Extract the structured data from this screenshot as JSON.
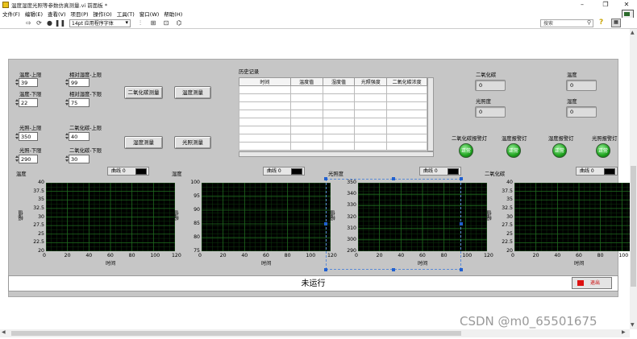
{
  "window": {
    "title": "温度湿度光照等参数仿真测量.vi 前面板 *",
    "controls": [
      "–",
      "❐",
      "✕"
    ]
  },
  "menu": [
    "文件(F)",
    "编辑(E)",
    "查看(V)",
    "项目(P)",
    "操作(O)",
    "工具(T)",
    "窗口(W)",
    "帮助(H)"
  ],
  "toolbar": {
    "font": "14pt 应用程序字体",
    "search_placeholder": "搜索",
    "help": "?"
  },
  "limits": [
    {
      "label": "温度-上限",
      "value": "39"
    },
    {
      "label": "相对湿度-上限",
      "value": "99"
    },
    {
      "label": "温度-下限",
      "value": "22"
    },
    {
      "label": "相对湿度-下限",
      "value": "75"
    },
    {
      "label": "光照-上限",
      "value": "350"
    },
    {
      "label": "二氧化碳-上限",
      "value": "40"
    },
    {
      "label": "光照-下限",
      "value": "290"
    },
    {
      "label": "二氧化碳-下限",
      "value": "30"
    }
  ],
  "buttons": {
    "co2": "二氧化碳测量",
    "temp": "温度测量",
    "humidity": "湿度测量",
    "light": "光照测量"
  },
  "history": {
    "label": "历史记录",
    "columns": [
      "时间",
      "温度值",
      "湿度值",
      "光照强度",
      "二氧化碳浓度"
    ]
  },
  "indicators": [
    {
      "label": "二氧化碳",
      "value": "0"
    },
    {
      "label": "温度",
      "value": "0"
    },
    {
      "label": "光照度",
      "value": "0"
    },
    {
      "label": "湿度",
      "value": "0"
    }
  ],
  "alarms": [
    {
      "label": "二氧化碳报警灯",
      "state": "正常"
    },
    {
      "label": "温度报警灯",
      "state": "正常"
    },
    {
      "label": "湿度报警灯",
      "state": "正常"
    },
    {
      "label": "光照报警灯",
      "state": "正常"
    }
  ],
  "charts": [
    {
      "title": "温度",
      "legend": "曲线 0",
      "ylabel": "幅值",
      "xlabel": "时间"
    },
    {
      "title": "湿度",
      "legend": "曲线 0",
      "ylabel": "幅值",
      "xlabel": "时间"
    },
    {
      "title": "光照度",
      "legend": "曲线 0",
      "ylabel": "幅值",
      "xlabel": "时间"
    },
    {
      "title": "二氧化碳",
      "legend": "曲线 0",
      "ylabel": "幅值",
      "xlabel": "时间"
    }
  ],
  "chart_data": [
    {
      "type": "line",
      "title": "温度",
      "xlabel": "时间",
      "ylabel": "幅值",
      "xlim": [
        0,
        120
      ],
      "ylim": [
        20,
        40
      ],
      "xticks": [
        "0",
        "20",
        "40",
        "60",
        "80",
        "100",
        "120"
      ],
      "yticks": [
        "20",
        "22.5",
        "25",
        "27.5",
        "30",
        "32.5",
        "35",
        "37.5",
        "40"
      ],
      "series": []
    },
    {
      "type": "line",
      "title": "湿度",
      "xlabel": "时间",
      "ylabel": "幅值",
      "xlim": [
        0,
        120
      ],
      "ylim": [
        75,
        100
      ],
      "xticks": [
        "0",
        "20",
        "40",
        "60",
        "80",
        "100",
        "120"
      ],
      "yticks": [
        "75",
        "80",
        "85",
        "90",
        "95",
        "100"
      ],
      "series": []
    },
    {
      "type": "line",
      "title": "光照度",
      "xlabel": "时间",
      "ylabel": "幅值",
      "xlim": [
        0,
        120
      ],
      "ylim": [
        290,
        350
      ],
      "xticks": [
        "0",
        "20",
        "40",
        "60",
        "80",
        "100",
        "120"
      ],
      "yticks": [
        "290",
        "300",
        "310",
        "320",
        "330",
        "340",
        "350"
      ],
      "series": []
    },
    {
      "type": "line",
      "title": "二氧化碳",
      "xlabel": "时间",
      "ylabel": "幅值",
      "xlim": [
        0,
        120
      ],
      "ylim": [
        20,
        40
      ],
      "xticks": [
        "0",
        "20",
        "40",
        "60",
        "80",
        "100",
        "120"
      ],
      "yticks": [
        "20",
        "22.5",
        "25",
        "27.5",
        "30",
        "32.5",
        "35",
        "37.5",
        "40"
      ],
      "series": []
    }
  ],
  "status": "未运行",
  "exit_label": "退出",
  "watermark": "CSDN @m0_65501675",
  "colors": {
    "panel": "#c6c6c6",
    "plot_bg": "#000000",
    "grid": "#1f6b1f",
    "led_on": "#1fa31f",
    "exit": "#dd1111"
  }
}
